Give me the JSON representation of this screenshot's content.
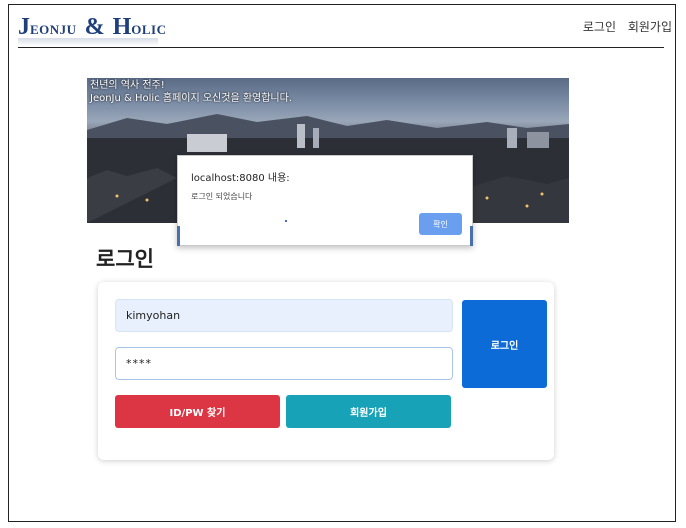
{
  "header": {
    "logo": {
      "word1_initial": "J",
      "word1_rest": "EONJU",
      "amp": "&",
      "word2_initial": "H",
      "word2_rest": "OLIC"
    },
    "nav": {
      "login": "로그인",
      "signup": "회원가입"
    }
  },
  "banner": {
    "line1": "천년의 역사 전주!",
    "line2": "JeonJu & Holic 홈페이지 오신것을 환영합니다."
  },
  "dialog": {
    "title": "localhost:8080 내용:",
    "message": "로그인 되었습니다",
    "confirm_label": "확인"
  },
  "login": {
    "title": "로그인",
    "id_value": "kimyohan",
    "pw_value": "****",
    "login_label": "로그인",
    "find_label": "ID/PW 찾기",
    "join_label": "회원가입"
  },
  "colors": {
    "login_button": "#0d6bd8",
    "find_button": "#dc3543",
    "join_button": "#17a2b8",
    "dialog_button": "#6a9ff0",
    "logo": "#1f3f7a"
  }
}
